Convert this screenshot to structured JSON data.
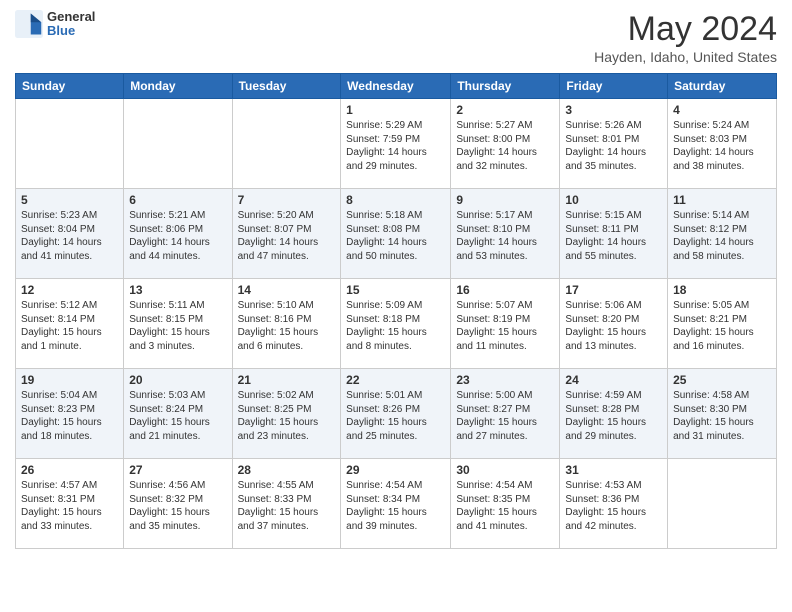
{
  "header": {
    "logo_general": "General",
    "logo_blue": "Blue",
    "month_title": "May 2024",
    "location": "Hayden, Idaho, United States"
  },
  "weekdays": [
    "Sunday",
    "Monday",
    "Tuesday",
    "Wednesday",
    "Thursday",
    "Friday",
    "Saturday"
  ],
  "weeks": [
    [
      {
        "day": "",
        "text": ""
      },
      {
        "day": "",
        "text": ""
      },
      {
        "day": "",
        "text": ""
      },
      {
        "day": "1",
        "text": "Sunrise: 5:29 AM\nSunset: 7:59 PM\nDaylight: 14 hours\nand 29 minutes."
      },
      {
        "day": "2",
        "text": "Sunrise: 5:27 AM\nSunset: 8:00 PM\nDaylight: 14 hours\nand 32 minutes."
      },
      {
        "day": "3",
        "text": "Sunrise: 5:26 AM\nSunset: 8:01 PM\nDaylight: 14 hours\nand 35 minutes."
      },
      {
        "day": "4",
        "text": "Sunrise: 5:24 AM\nSunset: 8:03 PM\nDaylight: 14 hours\nand 38 minutes."
      }
    ],
    [
      {
        "day": "5",
        "text": "Sunrise: 5:23 AM\nSunset: 8:04 PM\nDaylight: 14 hours\nand 41 minutes."
      },
      {
        "day": "6",
        "text": "Sunrise: 5:21 AM\nSunset: 8:06 PM\nDaylight: 14 hours\nand 44 minutes."
      },
      {
        "day": "7",
        "text": "Sunrise: 5:20 AM\nSunset: 8:07 PM\nDaylight: 14 hours\nand 47 minutes."
      },
      {
        "day": "8",
        "text": "Sunrise: 5:18 AM\nSunset: 8:08 PM\nDaylight: 14 hours\nand 50 minutes."
      },
      {
        "day": "9",
        "text": "Sunrise: 5:17 AM\nSunset: 8:10 PM\nDaylight: 14 hours\nand 53 minutes."
      },
      {
        "day": "10",
        "text": "Sunrise: 5:15 AM\nSunset: 8:11 PM\nDaylight: 14 hours\nand 55 minutes."
      },
      {
        "day": "11",
        "text": "Sunrise: 5:14 AM\nSunset: 8:12 PM\nDaylight: 14 hours\nand 58 minutes."
      }
    ],
    [
      {
        "day": "12",
        "text": "Sunrise: 5:12 AM\nSunset: 8:14 PM\nDaylight: 15 hours\nand 1 minute."
      },
      {
        "day": "13",
        "text": "Sunrise: 5:11 AM\nSunset: 8:15 PM\nDaylight: 15 hours\nand 3 minutes."
      },
      {
        "day": "14",
        "text": "Sunrise: 5:10 AM\nSunset: 8:16 PM\nDaylight: 15 hours\nand 6 minutes."
      },
      {
        "day": "15",
        "text": "Sunrise: 5:09 AM\nSunset: 8:18 PM\nDaylight: 15 hours\nand 8 minutes."
      },
      {
        "day": "16",
        "text": "Sunrise: 5:07 AM\nSunset: 8:19 PM\nDaylight: 15 hours\nand 11 minutes."
      },
      {
        "day": "17",
        "text": "Sunrise: 5:06 AM\nSunset: 8:20 PM\nDaylight: 15 hours\nand 13 minutes."
      },
      {
        "day": "18",
        "text": "Sunrise: 5:05 AM\nSunset: 8:21 PM\nDaylight: 15 hours\nand 16 minutes."
      }
    ],
    [
      {
        "day": "19",
        "text": "Sunrise: 5:04 AM\nSunset: 8:23 PM\nDaylight: 15 hours\nand 18 minutes."
      },
      {
        "day": "20",
        "text": "Sunrise: 5:03 AM\nSunset: 8:24 PM\nDaylight: 15 hours\nand 21 minutes."
      },
      {
        "day": "21",
        "text": "Sunrise: 5:02 AM\nSunset: 8:25 PM\nDaylight: 15 hours\nand 23 minutes."
      },
      {
        "day": "22",
        "text": "Sunrise: 5:01 AM\nSunset: 8:26 PM\nDaylight: 15 hours\nand 25 minutes."
      },
      {
        "day": "23",
        "text": "Sunrise: 5:00 AM\nSunset: 8:27 PM\nDaylight: 15 hours\nand 27 minutes."
      },
      {
        "day": "24",
        "text": "Sunrise: 4:59 AM\nSunset: 8:28 PM\nDaylight: 15 hours\nand 29 minutes."
      },
      {
        "day": "25",
        "text": "Sunrise: 4:58 AM\nSunset: 8:30 PM\nDaylight: 15 hours\nand 31 minutes."
      }
    ],
    [
      {
        "day": "26",
        "text": "Sunrise: 4:57 AM\nSunset: 8:31 PM\nDaylight: 15 hours\nand 33 minutes."
      },
      {
        "day": "27",
        "text": "Sunrise: 4:56 AM\nSunset: 8:32 PM\nDaylight: 15 hours\nand 35 minutes."
      },
      {
        "day": "28",
        "text": "Sunrise: 4:55 AM\nSunset: 8:33 PM\nDaylight: 15 hours\nand 37 minutes."
      },
      {
        "day": "29",
        "text": "Sunrise: 4:54 AM\nSunset: 8:34 PM\nDaylight: 15 hours\nand 39 minutes."
      },
      {
        "day": "30",
        "text": "Sunrise: 4:54 AM\nSunset: 8:35 PM\nDaylight: 15 hours\nand 41 minutes."
      },
      {
        "day": "31",
        "text": "Sunrise: 4:53 AM\nSunset: 8:36 PM\nDaylight: 15 hours\nand 42 minutes."
      },
      {
        "day": "",
        "text": ""
      }
    ]
  ]
}
